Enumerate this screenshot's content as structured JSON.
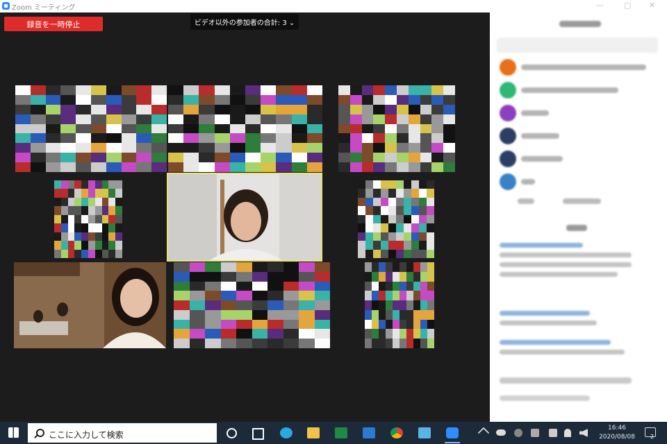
{
  "window": {
    "title": "Zoom ミーティング"
  },
  "toolbar": {
    "record_pause_label": "録音を一時停止"
  },
  "participants": {
    "label": "ビデオ以外の参加者の合計: 3 ⌄"
  },
  "taskbar": {
    "search_placeholder": "ここに入力して検索",
    "time": "16:46",
    "date": "2020/08/08",
    "notification_count": "2"
  },
  "icons": {
    "windows": "windows-start-icon",
    "search": "search-icon",
    "cortana": "cortana-icon",
    "taskview": "task-view-icon",
    "edge": "edge-icon",
    "explorer": "file-explorer-icon",
    "excel": "excel-icon",
    "photos": "photos-icon",
    "chrome": "chrome-icon",
    "notes": "notes-icon",
    "zoom": "zoom-icon"
  },
  "colors": {
    "record": "#e02b2b",
    "active_speaker": "#e8e27a",
    "taskbar": "#1c2a3a"
  }
}
